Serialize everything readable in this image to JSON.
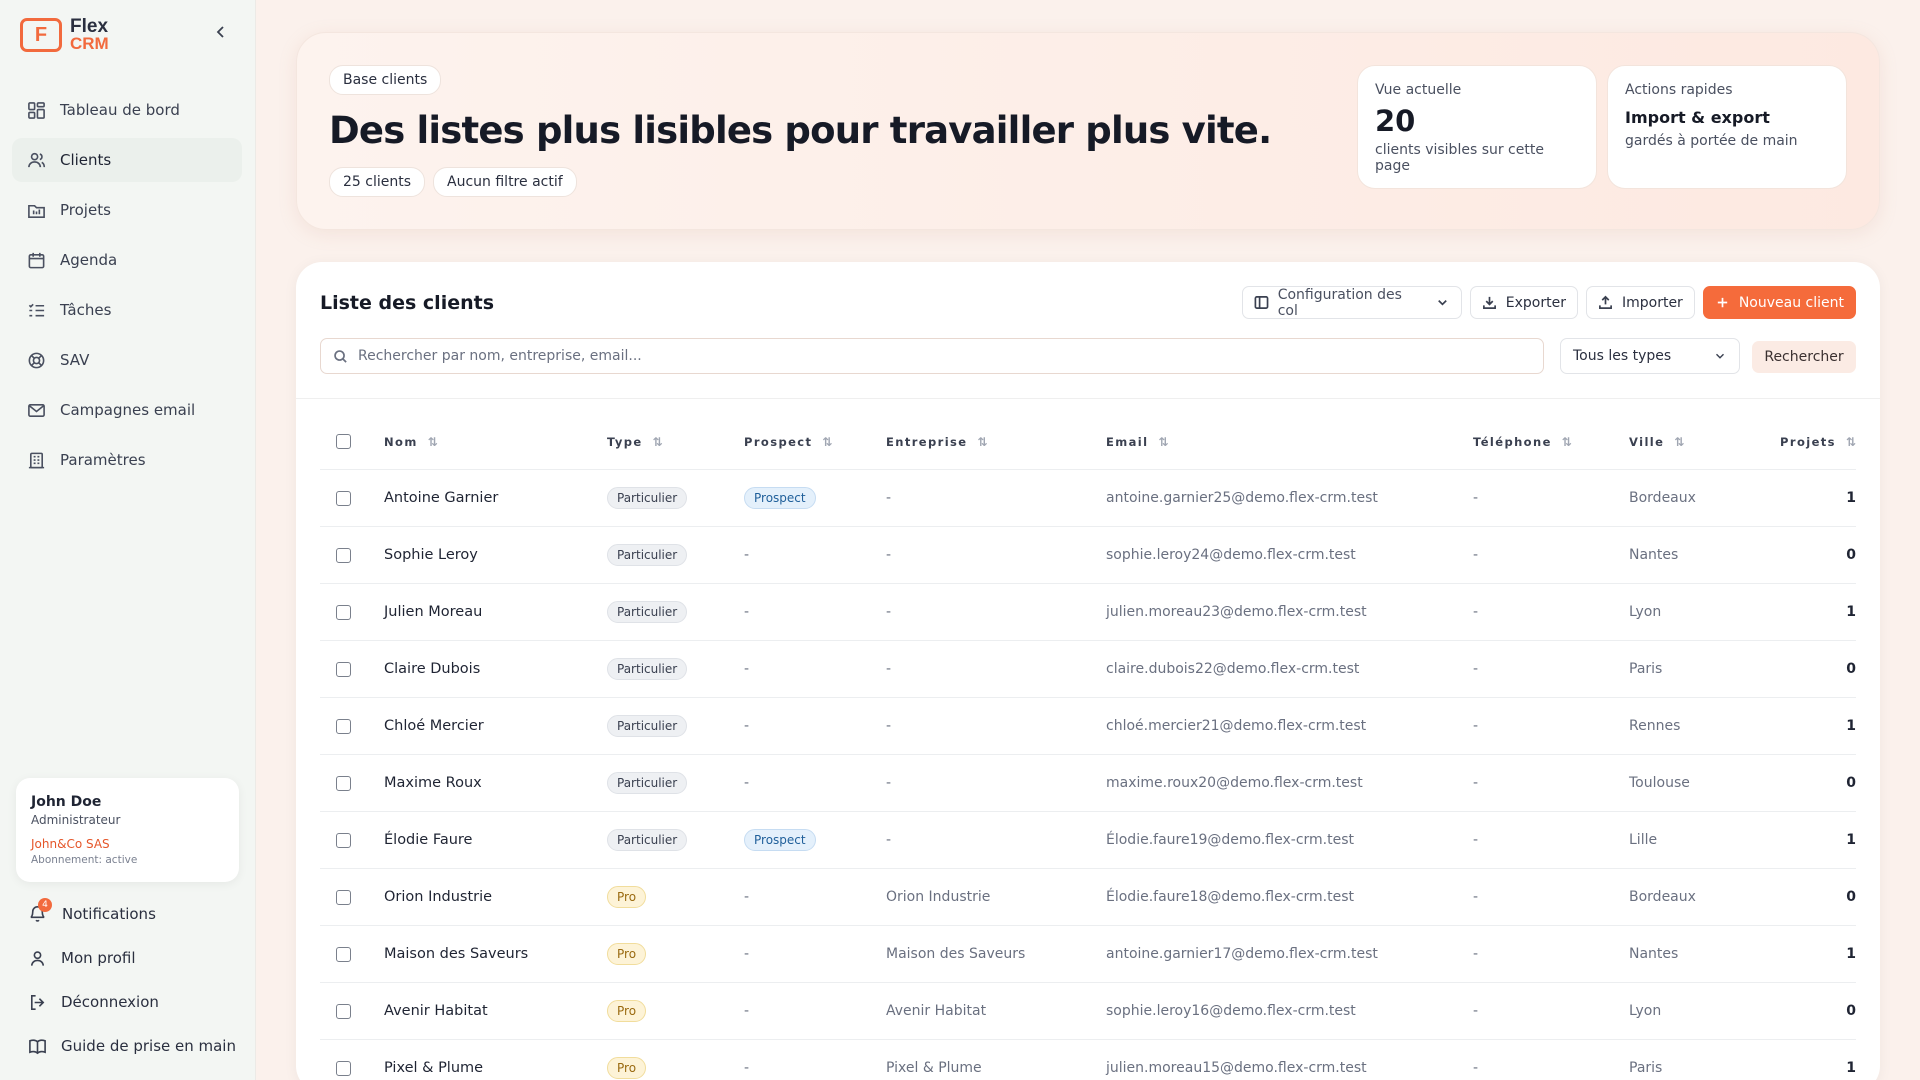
{
  "logo": {
    "mark": "F",
    "line1": "Flex",
    "line2": "CRM"
  },
  "sidebar": {
    "items": [
      {
        "label": "Tableau de bord",
        "icon": "dashboard-icon"
      },
      {
        "label": "Clients",
        "icon": "users-icon"
      },
      {
        "label": "Projets",
        "icon": "projects-icon"
      },
      {
        "label": "Agenda",
        "icon": "calendar-icon"
      },
      {
        "label": "Tâches",
        "icon": "tasks-icon"
      },
      {
        "label": "SAV",
        "icon": "support-icon"
      },
      {
        "label": "Campagnes email",
        "icon": "mail-icon"
      },
      {
        "label": "Paramètres",
        "icon": "settings-icon"
      }
    ],
    "active_index": 1
  },
  "user": {
    "name": "John Doe",
    "role": "Administrateur",
    "company": "John&Co SAS",
    "subscription": "Abonnement: active"
  },
  "bottom_links": {
    "notifications": "Notifications",
    "notifications_count": "4",
    "profile": "Mon profil",
    "logout": "Déconnexion",
    "guide": "Guide de prise en main"
  },
  "hero": {
    "chip": "Base clients",
    "title": "Des listes plus lisibles pour travailler plus vite.",
    "count_chip": "25 clients",
    "filter_chip": "Aucun filtre actif",
    "stat1": {
      "label": "Vue actuelle",
      "value": "20",
      "desc": "clients visibles sur cette page"
    },
    "stat2": {
      "label": "Actions rapides",
      "title": "Import & export",
      "desc": "gardés à portée de main"
    }
  },
  "list": {
    "title": "Liste des clients",
    "config_label": "Configuration des col",
    "export_label": "Exporter",
    "import_label": "Importer",
    "new_label": "Nouveau client",
    "search_placeholder": "Rechercher par nom, entreprise, email...",
    "type_select": "Tous les types",
    "search_button": "Rechercher",
    "columns": [
      "Nom",
      "Type",
      "Prospect",
      "Entreprise",
      "Email",
      "Téléphone",
      "Ville",
      "Projets"
    ],
    "rows": [
      {
        "nom": "Antoine Garnier",
        "type": "Particulier",
        "prospect": "Prospect",
        "entreprise": "-",
        "email": "antoine.garnier25@demo.flex-crm.test",
        "tel": "-",
        "ville": "Bordeaux",
        "projets": "1"
      },
      {
        "nom": "Sophie Leroy",
        "type": "Particulier",
        "prospect": "-",
        "entreprise": "-",
        "email": "sophie.leroy24@demo.flex-crm.test",
        "tel": "-",
        "ville": "Nantes",
        "projets": "0"
      },
      {
        "nom": "Julien Moreau",
        "type": "Particulier",
        "prospect": "-",
        "entreprise": "-",
        "email": "julien.moreau23@demo.flex-crm.test",
        "tel": "-",
        "ville": "Lyon",
        "projets": "1"
      },
      {
        "nom": "Claire Dubois",
        "type": "Particulier",
        "prospect": "-",
        "entreprise": "-",
        "email": "claire.dubois22@demo.flex-crm.test",
        "tel": "-",
        "ville": "Paris",
        "projets": "0"
      },
      {
        "nom": "Chloé Mercier",
        "type": "Particulier",
        "prospect": "-",
        "entreprise": "-",
        "email": "chloé.mercier21@demo.flex-crm.test",
        "tel": "-",
        "ville": "Rennes",
        "projets": "1"
      },
      {
        "nom": "Maxime Roux",
        "type": "Particulier",
        "prospect": "-",
        "entreprise": "-",
        "email": "maxime.roux20@demo.flex-crm.test",
        "tel": "-",
        "ville": "Toulouse",
        "projets": "0"
      },
      {
        "nom": "Élodie Faure",
        "type": "Particulier",
        "prospect": "Prospect",
        "entreprise": "-",
        "email": "Élodie.faure19@demo.flex-crm.test",
        "tel": "-",
        "ville": "Lille",
        "projets": "1"
      },
      {
        "nom": "Orion Industrie",
        "type": "Pro",
        "prospect": "-",
        "entreprise": "Orion Industrie",
        "email": "Élodie.faure18@demo.flex-crm.test",
        "tel": "-",
        "ville": "Bordeaux",
        "projets": "0"
      },
      {
        "nom": "Maison des Saveurs",
        "type": "Pro",
        "prospect": "-",
        "entreprise": "Maison des Saveurs",
        "email": "antoine.garnier17@demo.flex-crm.test",
        "tel": "-",
        "ville": "Nantes",
        "projets": "1"
      },
      {
        "nom": "Avenir Habitat",
        "type": "Pro",
        "prospect": "-",
        "entreprise": "Avenir Habitat",
        "email": "sophie.leroy16@demo.flex-crm.test",
        "tel": "-",
        "ville": "Lyon",
        "projets": "0"
      },
      {
        "nom": "Pixel & Plume",
        "type": "Pro",
        "prospect": "-",
        "entreprise": "Pixel & Plume",
        "email": "julien.moreau15@demo.flex-crm.test",
        "tel": "-",
        "ville": "Paris",
        "projets": "1"
      }
    ]
  },
  "colors": {
    "accent": "#f56b3b",
    "sidebar_bg": "#f3f6f3",
    "page_bg": "#fbf1ec"
  }
}
